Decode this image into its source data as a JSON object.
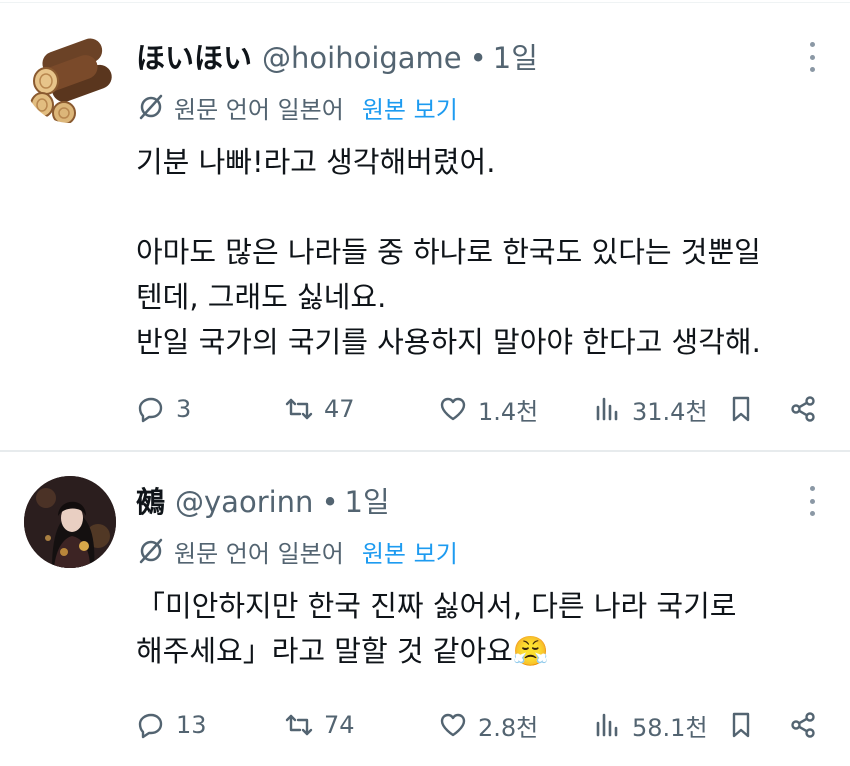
{
  "tweets": [
    {
      "display_name": "ほいほい",
      "handle": "@hoihoigame",
      "separator": "•",
      "time": "1일",
      "avatar_icon": "firewood-logs-icon",
      "translation": {
        "note": "원문 언어 일본어",
        "show_original": "원본 보기"
      },
      "lines": [
        "기분 나빠!라고 생각해버렸어.",
        "",
        "아마도 많은 나라들 중 하나로 한국도 있다는 것뿐일",
        "텐데, 그래도 싫네요.",
        "반일 국가의 국기를 사용하지 말아야 한다고 생각해."
      ],
      "stats": {
        "replies": "3",
        "retweets": "47",
        "likes": "1.4천",
        "views": "31.4천"
      }
    },
    {
      "display_name": "鵺",
      "handle": "@yaorinn",
      "separator": "•",
      "time": "1일",
      "avatar_icon": "anime-portrait-avatar",
      "translation": {
        "note": "원문 언어 일본어",
        "show_original": "원본 보기"
      },
      "lines": [
        "「미안하지만 한국 진짜 싫어서, 다른 나라 국기로",
        "해주세요」라고 말할 것 같아요😤"
      ],
      "stats": {
        "replies": "13",
        "retweets": "74",
        "likes": "2.8천",
        "views": "58.1천"
      }
    }
  ],
  "colors": {
    "text": "#0f1419",
    "secondary": "#536471",
    "link": "#1d9bf0",
    "divider": "#e7ebed"
  }
}
